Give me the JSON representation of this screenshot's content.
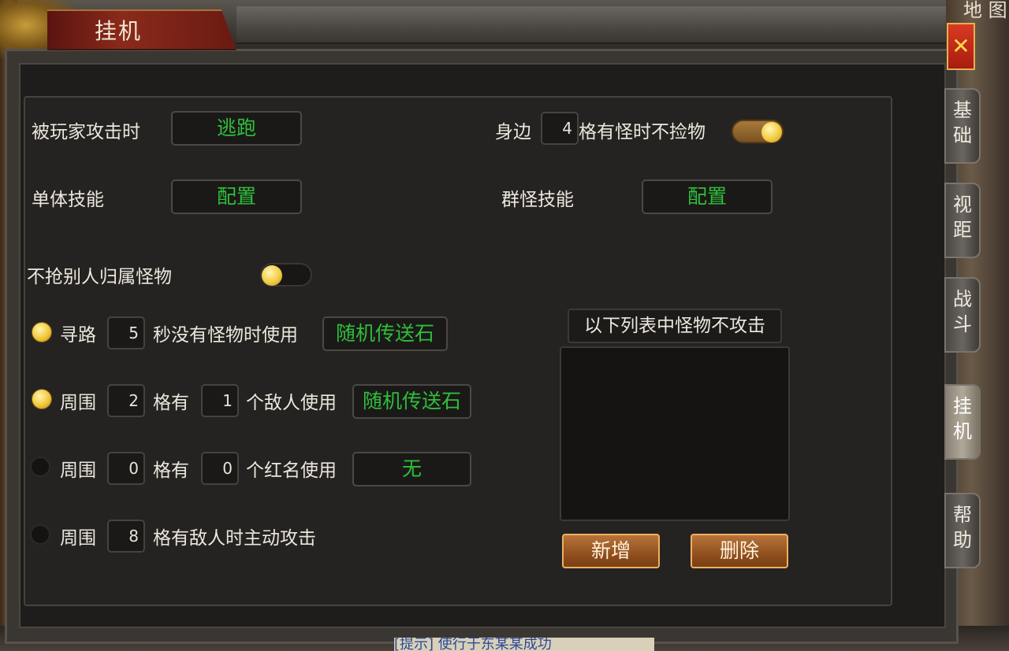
{
  "window": {
    "title": "挂机",
    "close_symbol": "✕",
    "top_right_partial": "地 图"
  },
  "side_tabs": [
    {
      "label": "基础",
      "active": false
    },
    {
      "label": "视距",
      "active": false
    },
    {
      "label": "战斗",
      "active": false
    },
    {
      "label": "挂机",
      "active": true
    },
    {
      "label": "帮助",
      "active": false
    }
  ],
  "settings": {
    "attacked_by_player_label": "被玩家攻击时",
    "attacked_by_player_value": "逃跑",
    "nearby_prefix": "身边",
    "nearby_cells": "4",
    "nearby_suffix": "格有怪时不捡物",
    "nearby_toggle_on": true,
    "single_skill_label": "单体技能",
    "single_skill_value": "配置",
    "group_skill_label": "群怪技能",
    "group_skill_value": "配置",
    "no_steal_label": "不抢别人归属怪物",
    "no_steal_toggle_on": false
  },
  "rules": [
    {
      "enabled": true,
      "prefix": "寻路",
      "n1": "5",
      "middle": "秒没有怪物时使用",
      "action": "随机传送石"
    },
    {
      "enabled": true,
      "prefix": "周围",
      "n1": "2",
      "middle": "格有",
      "n2": "1",
      "suffix": "个敌人使用",
      "action": "随机传送石"
    },
    {
      "enabled": false,
      "prefix": "周围",
      "n1": "0",
      "middle": "格有",
      "n2": "0",
      "suffix": "个红名使用",
      "action": "无"
    },
    {
      "enabled": false,
      "prefix": "周围",
      "n1": "8",
      "middle": "格有敌人时主动攻击"
    }
  ],
  "exclude_list": {
    "header": "以下列表中怪物不攻击",
    "items": [],
    "add_label": "新增",
    "delete_label": "删除"
  },
  "bottom_hint": "[提示] 使行于东某某成功",
  "colors": {
    "accent_green": "#2fbf3a",
    "gold": "#f2c83a",
    "close_red": "#c82a18"
  }
}
